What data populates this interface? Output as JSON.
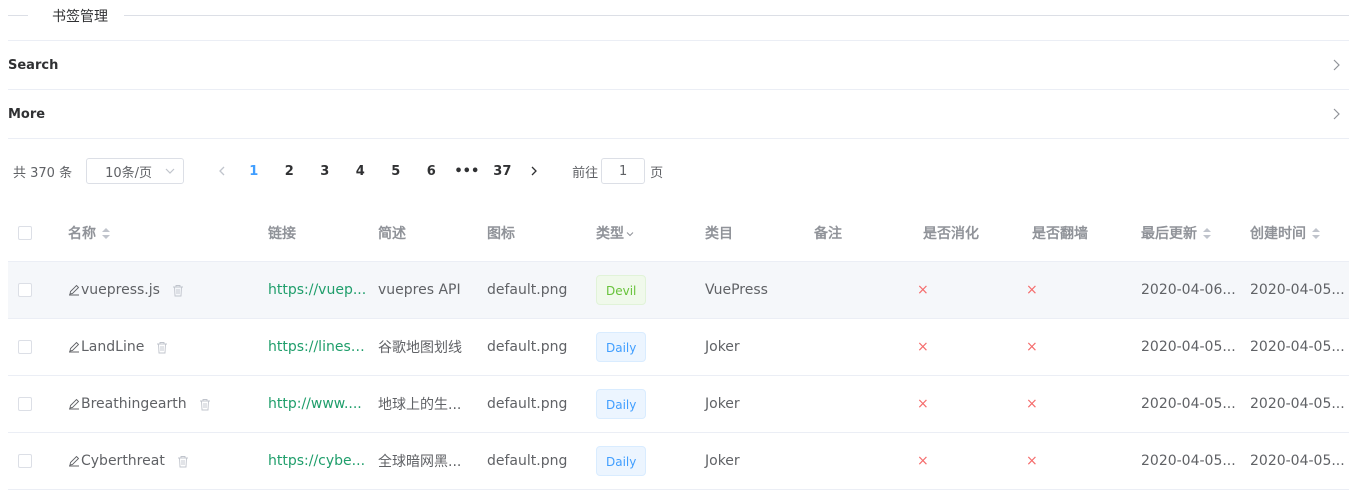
{
  "section_title": "书签管理",
  "collapse": [
    {
      "label": "Search"
    },
    {
      "label": "More"
    }
  ],
  "pagination": {
    "total": "共 370 条",
    "page_size": "10条/页",
    "pages": [
      "1",
      "2",
      "3",
      "4",
      "5",
      "6",
      "•••",
      "37"
    ],
    "active_page": "1",
    "goto_label": "前往",
    "goto_value": "1",
    "goto_suffix": "页"
  },
  "table": {
    "headers": {
      "name": "名称",
      "link": "链接",
      "desc": "简述",
      "icon": "图标",
      "type": "类型",
      "category": "类目",
      "note": "备注",
      "digested": "是否消化",
      "vpn": "是否翻墙",
      "updated": "最后更新",
      "created": "创建时间"
    },
    "rows": [
      {
        "name": "vuepress.js",
        "link": "https://vuep...",
        "desc": "vuepres API",
        "icon": "default.png",
        "type": "Devil",
        "type_color": "green",
        "category": "VuePress",
        "note": "",
        "digested": "×",
        "vpn": "×",
        "updated": "2020-04-06...",
        "created": "2020-04-05..."
      },
      {
        "name": "LandLine",
        "link": "https://lines....",
        "desc": "谷歌地图划线",
        "icon": "default.png",
        "type": "Daily",
        "type_color": "blue",
        "category": "Joker",
        "note": "",
        "digested": "×",
        "vpn": "×",
        "updated": "2020-04-05...",
        "created": "2020-04-05..."
      },
      {
        "name": "Breathingearth",
        "link": "http://www....",
        "desc": "地球上的生...",
        "icon": "default.png",
        "type": "Daily",
        "type_color": "blue",
        "category": "Joker",
        "note": "",
        "digested": "×",
        "vpn": "×",
        "updated": "2020-04-05...",
        "created": "2020-04-05..."
      },
      {
        "name": "Cyberthreat",
        "link": "https://cybe...",
        "desc": "全球暗网黑...",
        "icon": "default.png",
        "type": "Daily",
        "type_color": "blue",
        "category": "Joker",
        "note": "",
        "digested": "×",
        "vpn": "×",
        "updated": "2020-04-05...",
        "created": "2020-04-05..."
      }
    ]
  },
  "colors": {
    "accent": "#409eff",
    "link": "#1f9e6b",
    "danger": "#f56c6c",
    "success": "#67c23a"
  },
  "icons": {
    "edit": "edit-icon",
    "delete": "trash-icon",
    "expand": "chevron-right-icon"
  }
}
